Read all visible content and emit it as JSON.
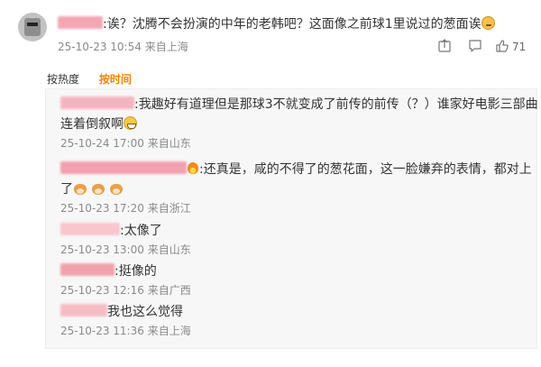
{
  "main_comment": {
    "text": ":诶？沈腾不会扮演的中年的老韩吧？这面像之前球1里说过的葱面诶",
    "emoji": "thinking-face-emoji",
    "date": "25-10-23 10:54",
    "location": "来自上海",
    "like_count": "71"
  },
  "sort": {
    "by_hot": "按热度",
    "by_time": "按时间",
    "active_color": "#ff8200"
  },
  "replies": [
    {
      "text_line1": ":我趣好有道理但是那球3不就变成了前传的前传（？）谁家好电影三部曲",
      "text_line2": "连着倒叙啊",
      "date": "25-10-24 17:00",
      "location": "来自山东"
    },
    {
      "text_line1": ":还真是，咸的不得了的葱花面，这一脸嫌弃的表情，都对上",
      "text_line2": "了",
      "date": "25-10-23 17:20",
      "location": "来自浙江"
    },
    {
      "text": ":太像了",
      "date": "25-10-23 13:00",
      "location": "来自山东"
    },
    {
      "text": ":挺像的",
      "date": "25-10-23 12:16",
      "location": "来自广西"
    },
    {
      "text": "我也这么觉得",
      "date": "25-10-23 11:36",
      "location": "来自上海"
    }
  ],
  "colors": {
    "meta": "#8a8a8a",
    "panel_bg": "#f7f7f7",
    "blurred_username": "#f3a6b2"
  }
}
